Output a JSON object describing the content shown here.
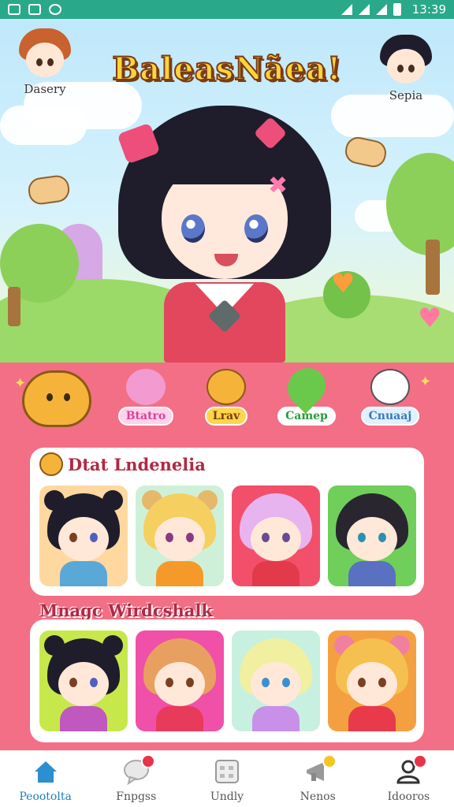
{
  "status_bar": {
    "time": "13:39"
  },
  "header": {
    "title": "BaleasNãea!",
    "left_profile": {
      "name": "Dasery"
    },
    "right_profile": {
      "name": "Sepia"
    }
  },
  "categories": [
    {
      "label": "Btatro",
      "color": "#d9419a",
      "icon": "pig-icon"
    },
    {
      "label": "Lrav",
      "color": "#7a3b12",
      "icon": "bear-icon"
    },
    {
      "label": "Camep",
      "color": "#2a9a3a",
      "icon": "heart-icon"
    },
    {
      "label": "Cnuaaj",
      "color": "#3a7ab8",
      "icon": "polar-bear-icon"
    }
  ],
  "sections": [
    {
      "title": "Dtat Lndenelia"
    },
    {
      "title": "Mnagc Wirdcshalk"
    }
  ],
  "bottom_nav": [
    {
      "label": "Peootolta",
      "icon": "home-icon",
      "active": true
    },
    {
      "label": "Fnpgss",
      "icon": "chat-icon",
      "badge": true
    },
    {
      "label": "Undly",
      "icon": "calendar-icon"
    },
    {
      "label": "Nenos",
      "icon": "megaphone-icon",
      "badge": true
    },
    {
      "label": "Idooros",
      "icon": "profile-icon",
      "badge": true
    }
  ]
}
